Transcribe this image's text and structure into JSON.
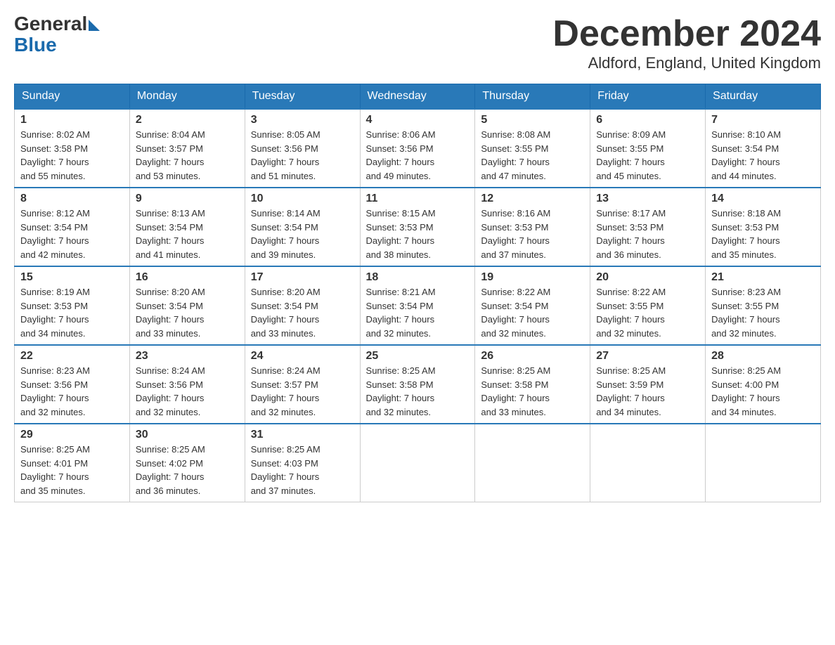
{
  "header": {
    "logo_general": "General",
    "logo_blue": "Blue",
    "month_title": "December 2024",
    "location": "Aldford, England, United Kingdom"
  },
  "weekdays": [
    "Sunday",
    "Monday",
    "Tuesday",
    "Wednesday",
    "Thursday",
    "Friday",
    "Saturday"
  ],
  "weeks": [
    [
      {
        "day": "1",
        "sunrise": "8:02 AM",
        "sunset": "3:58 PM",
        "daylight": "7 hours and 55 minutes."
      },
      {
        "day": "2",
        "sunrise": "8:04 AM",
        "sunset": "3:57 PM",
        "daylight": "7 hours and 53 minutes."
      },
      {
        "day": "3",
        "sunrise": "8:05 AM",
        "sunset": "3:56 PM",
        "daylight": "7 hours and 51 minutes."
      },
      {
        "day": "4",
        "sunrise": "8:06 AM",
        "sunset": "3:56 PM",
        "daylight": "7 hours and 49 minutes."
      },
      {
        "day": "5",
        "sunrise": "8:08 AM",
        "sunset": "3:55 PM",
        "daylight": "7 hours and 47 minutes."
      },
      {
        "day": "6",
        "sunrise": "8:09 AM",
        "sunset": "3:55 PM",
        "daylight": "7 hours and 45 minutes."
      },
      {
        "day": "7",
        "sunrise": "8:10 AM",
        "sunset": "3:54 PM",
        "daylight": "7 hours and 44 minutes."
      }
    ],
    [
      {
        "day": "8",
        "sunrise": "8:12 AM",
        "sunset": "3:54 PM",
        "daylight": "7 hours and 42 minutes."
      },
      {
        "day": "9",
        "sunrise": "8:13 AM",
        "sunset": "3:54 PM",
        "daylight": "7 hours and 41 minutes."
      },
      {
        "day": "10",
        "sunrise": "8:14 AM",
        "sunset": "3:54 PM",
        "daylight": "7 hours and 39 minutes."
      },
      {
        "day": "11",
        "sunrise": "8:15 AM",
        "sunset": "3:53 PM",
        "daylight": "7 hours and 38 minutes."
      },
      {
        "day": "12",
        "sunrise": "8:16 AM",
        "sunset": "3:53 PM",
        "daylight": "7 hours and 37 minutes."
      },
      {
        "day": "13",
        "sunrise": "8:17 AM",
        "sunset": "3:53 PM",
        "daylight": "7 hours and 36 minutes."
      },
      {
        "day": "14",
        "sunrise": "8:18 AM",
        "sunset": "3:53 PM",
        "daylight": "7 hours and 35 minutes."
      }
    ],
    [
      {
        "day": "15",
        "sunrise": "8:19 AM",
        "sunset": "3:53 PM",
        "daylight": "7 hours and 34 minutes."
      },
      {
        "day": "16",
        "sunrise": "8:20 AM",
        "sunset": "3:54 PM",
        "daylight": "7 hours and 33 minutes."
      },
      {
        "day": "17",
        "sunrise": "8:20 AM",
        "sunset": "3:54 PM",
        "daylight": "7 hours and 33 minutes."
      },
      {
        "day": "18",
        "sunrise": "8:21 AM",
        "sunset": "3:54 PM",
        "daylight": "7 hours and 32 minutes."
      },
      {
        "day": "19",
        "sunrise": "8:22 AM",
        "sunset": "3:54 PM",
        "daylight": "7 hours and 32 minutes."
      },
      {
        "day": "20",
        "sunrise": "8:22 AM",
        "sunset": "3:55 PM",
        "daylight": "7 hours and 32 minutes."
      },
      {
        "day": "21",
        "sunrise": "8:23 AM",
        "sunset": "3:55 PM",
        "daylight": "7 hours and 32 minutes."
      }
    ],
    [
      {
        "day": "22",
        "sunrise": "8:23 AM",
        "sunset": "3:56 PM",
        "daylight": "7 hours and 32 minutes."
      },
      {
        "day": "23",
        "sunrise": "8:24 AM",
        "sunset": "3:56 PM",
        "daylight": "7 hours and 32 minutes."
      },
      {
        "day": "24",
        "sunrise": "8:24 AM",
        "sunset": "3:57 PM",
        "daylight": "7 hours and 32 minutes."
      },
      {
        "day": "25",
        "sunrise": "8:25 AM",
        "sunset": "3:58 PM",
        "daylight": "7 hours and 32 minutes."
      },
      {
        "day": "26",
        "sunrise": "8:25 AM",
        "sunset": "3:58 PM",
        "daylight": "7 hours and 33 minutes."
      },
      {
        "day": "27",
        "sunrise": "8:25 AM",
        "sunset": "3:59 PM",
        "daylight": "7 hours and 34 minutes."
      },
      {
        "day": "28",
        "sunrise": "8:25 AM",
        "sunset": "4:00 PM",
        "daylight": "7 hours and 34 minutes."
      }
    ],
    [
      {
        "day": "29",
        "sunrise": "8:25 AM",
        "sunset": "4:01 PM",
        "daylight": "7 hours and 35 minutes."
      },
      {
        "day": "30",
        "sunrise": "8:25 AM",
        "sunset": "4:02 PM",
        "daylight": "7 hours and 36 minutes."
      },
      {
        "day": "31",
        "sunrise": "8:25 AM",
        "sunset": "4:03 PM",
        "daylight": "7 hours and 37 minutes."
      },
      null,
      null,
      null,
      null
    ]
  ],
  "labels": {
    "sunrise": "Sunrise:",
    "sunset": "Sunset:",
    "daylight": "Daylight:"
  }
}
